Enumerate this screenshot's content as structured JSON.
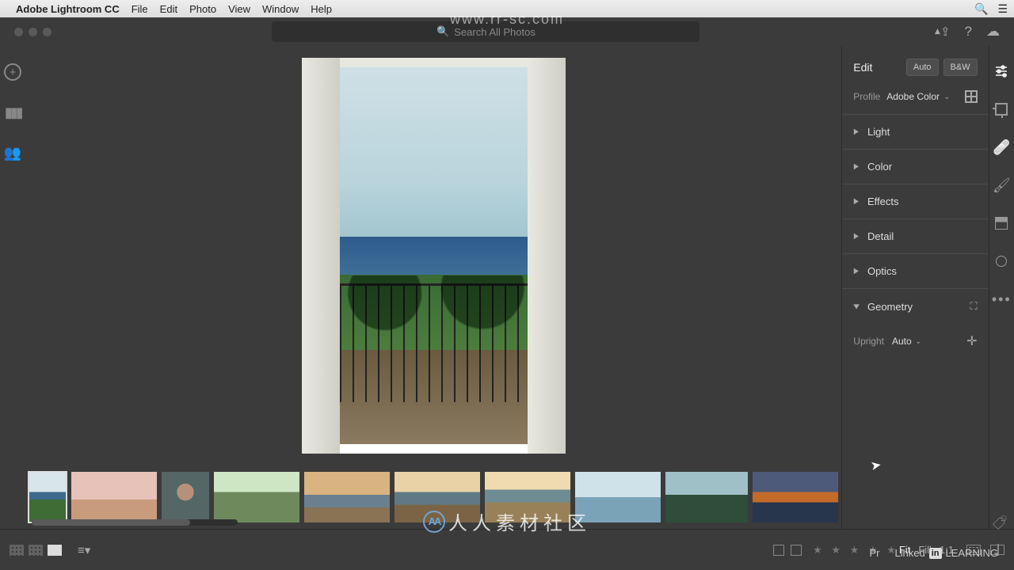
{
  "mac_menu": {
    "app_title": "Adobe Lightroom CC",
    "items": [
      "File",
      "Edit",
      "Photo",
      "View",
      "Window",
      "Help"
    ]
  },
  "search": {
    "placeholder": "Search All Photos"
  },
  "watermark_url": "www.rr-sc.com",
  "brand_text": "人人素材社区",
  "edit_panel": {
    "title": "Edit",
    "auto_btn": "Auto",
    "bw_btn": "B&W",
    "profile_label": "Profile",
    "profile_value": "Adobe Color",
    "sections": [
      {
        "label": "Light"
      },
      {
        "label": "Color"
      },
      {
        "label": "Effects"
      },
      {
        "label": "Detail"
      },
      {
        "label": "Optics"
      }
    ],
    "geometry": {
      "label": "Geometry",
      "upright_label": "Upright",
      "upright_value": "Auto"
    }
  },
  "footer": {
    "zoom_fit": "Fit",
    "zoom_fill": "Fill",
    "zoom_11": "1:1"
  },
  "linkedin": {
    "pre": "Pr",
    "word1": "Linked",
    "in": "in",
    "word2": "LEARNING"
  },
  "thumbnails": [
    0,
    1,
    2,
    3,
    4,
    5,
    6,
    7,
    8,
    9
  ]
}
